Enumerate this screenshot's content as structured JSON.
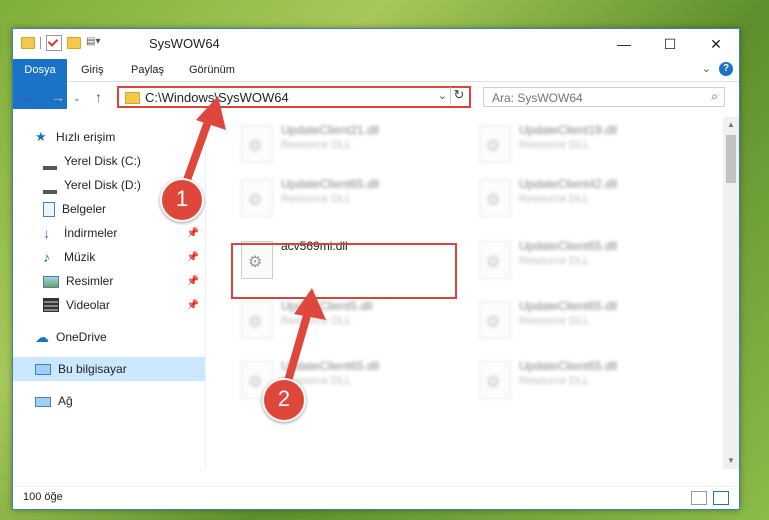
{
  "window": {
    "title": "SysWOW64",
    "controls": {
      "minimize": "—",
      "maximize": "☐",
      "close": "✕"
    }
  },
  "ribbon": {
    "tabs": [
      "Dosya",
      "Giriş",
      "Paylaş",
      "Görünüm"
    ],
    "help_label": "?"
  },
  "address": {
    "path": "C:\\Windows\\SysWOW64"
  },
  "search": {
    "placeholder": "Ara: SysWOW64"
  },
  "sidebar": {
    "quick_access": "Hızlı erişim",
    "items": [
      {
        "label": "Yerel Disk (C:)"
      },
      {
        "label": "Yerel Disk (D:)"
      },
      {
        "label": "Belgeler"
      },
      {
        "label": "İndirmeler"
      },
      {
        "label": "Müzik"
      },
      {
        "label": "Resimler"
      },
      {
        "label": "Videolar"
      }
    ],
    "onedrive": "OneDrive",
    "this_pc": "Bu bilgisayar",
    "network": "Ağ"
  },
  "files": {
    "left": [
      {
        "name": "UpdateClient21.dll",
        "desc": "Resource DLL"
      },
      {
        "name": "UpdateClient65.dll",
        "desc": "Resource DLL"
      },
      {
        "name": "acv569mi.dll",
        "desc": ""
      },
      {
        "name": "UpdateClient5.dll",
        "desc": "Resource DLL"
      },
      {
        "name": "UpdateClient65.dll",
        "desc": "Resource DLL"
      }
    ],
    "right": [
      {
        "name": "UpdateClient19.dll",
        "desc": "Resource DLL"
      },
      {
        "name": "UpdateClient42.dll",
        "desc": "Resource DLL"
      },
      {
        "name": "UpdateClient65.dll",
        "desc": "Resource DLL"
      },
      {
        "name": "UpdateClient65.dll",
        "desc": "Resource DLL"
      },
      {
        "name": "UpdateClient65.dll",
        "desc": "Resource DLL"
      }
    ]
  },
  "status": {
    "count": "100 öğe"
  },
  "callouts": [
    "1",
    "2"
  ],
  "colors": {
    "accent": "#1a73c7",
    "highlight": "#d9443b",
    "selection": "#cce8ff"
  }
}
